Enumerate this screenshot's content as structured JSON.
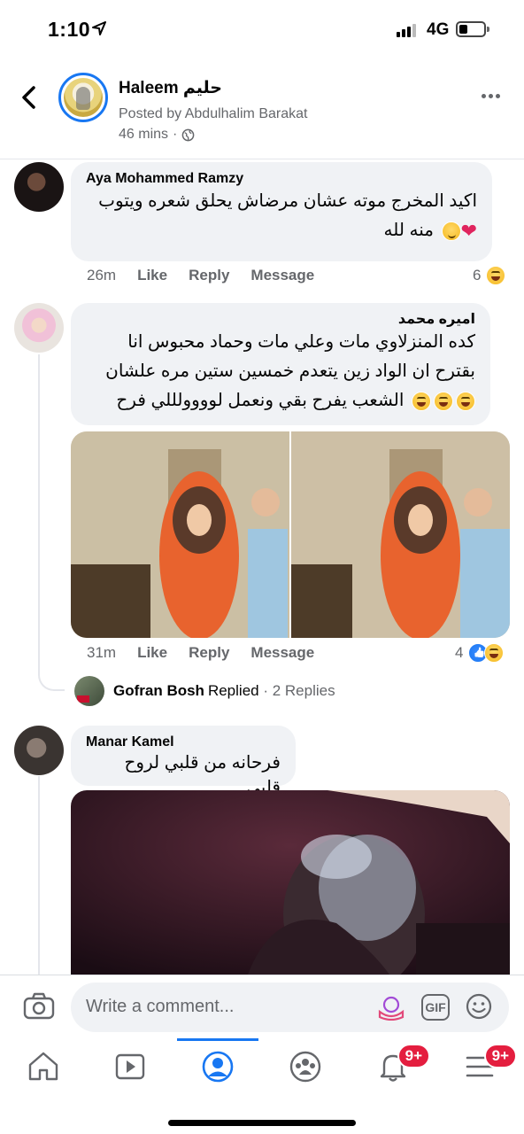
{
  "status_bar": {
    "time": "1:10",
    "network": "4G"
  },
  "header": {
    "page_name": "Haleem حليم",
    "posted_by": "Posted by Abdulhalim Barakat",
    "time": "46 mins",
    "privacy_icon": "globe-icon"
  },
  "comments": [
    {
      "name": "Aya Mohammed Ramzy",
      "line1": "اكيد المخرج موته عشان مرضاش يحلق شعره ويتوب",
      "line2": "منه لله",
      "time": "26m",
      "like": "Like",
      "reply": "Reply",
      "message": "Message",
      "reaction_count": "6"
    },
    {
      "name": "اميره محمد",
      "line1": "كده المنزلاوي مات وعلي مات وحماد محبوس انا",
      "line2": "بقترح ان  الواد زين يتعدم خمسين ستين مره علشان",
      "line3": "الشعب يفرح بقي ونعمل لوووولللي فرح",
      "time": "31m",
      "like": "Like",
      "reply": "Reply",
      "message": "Message",
      "reaction_count": "4",
      "replies": {
        "name": "Gofran Bosh",
        "verb": "Replied",
        "count": "· 2 Replies"
      }
    },
    {
      "name": "Manar Kamel",
      "line1": "فرحانه من قلبي لروح قلبي"
    }
  ],
  "composer": {
    "placeholder": "Write a comment...",
    "gif_label": "GIF"
  },
  "tabbar": {
    "tabs": [
      "home",
      "watch",
      "profile",
      "groups",
      "notifications",
      "menu"
    ],
    "notifications_badge": "9+",
    "menu_badge": "9+",
    "accent": "#1877f2",
    "badge_color": "#e41e3f"
  }
}
